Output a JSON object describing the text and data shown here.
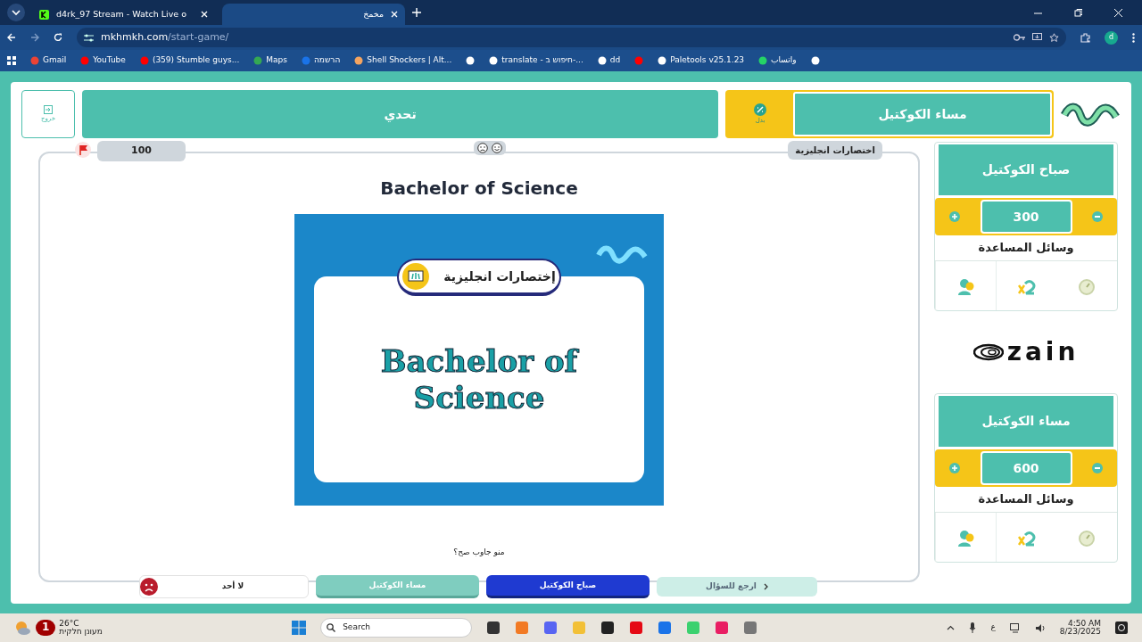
{
  "browser": {
    "tabs": [
      {
        "title": "مخمخ",
        "selected": true
      },
      {
        "title": "d4rk_97 Stream - Watch Live o",
        "selected": false
      }
    ],
    "address": {
      "host": "mkhmkh.com",
      "path": "/start-game/"
    },
    "profile_initial": "d",
    "bookmarks": [
      {
        "kind": "icon"
      },
      {
        "kind": "link",
        "label": "واتساب"
      },
      {
        "kind": "link",
        "label": "Paletools v25.1.23"
      },
      {
        "kind": "icon"
      },
      {
        "kind": "link",
        "label": "dd"
      },
      {
        "kind": "link",
        "label": "translate - חיפוש ב-..."
      },
      {
        "kind": "icon"
      },
      {
        "kind": "link",
        "label": "Shell Shockers | Alt..."
      },
      {
        "kind": "link",
        "label": "הרשמה"
      },
      {
        "kind": "link",
        "label": "Maps"
      },
      {
        "kind": "link",
        "label": "(359) Stumble guys..."
      },
      {
        "kind": "link",
        "label": "YouTube"
      },
      {
        "kind": "link",
        "label": "Gmail"
      }
    ]
  },
  "header": {
    "current_team": "مساء الكوكتيل",
    "swap_label": "بدل",
    "challenge_label": "تحدي",
    "exit_label": "خروج"
  },
  "teams": [
    {
      "name": "صباح الكوكتيل",
      "score": "300",
      "aids_label": "وسائل المساعدة"
    },
    {
      "name": "مساء الكوكتيل",
      "score": "600",
      "aids_label": "وسائل المساعدة"
    }
  ],
  "sponsor": "zain",
  "board": {
    "category": "اختصارات انجليزية",
    "points": "100",
    "question": "Bachelor of Science",
    "card": {
      "category": "إختصارات انجليزية",
      "text_lines": [
        "Bachelor of",
        "Science"
      ]
    },
    "prompt": "منو جاوب صح؟",
    "back_label": "ارجع للسؤال",
    "answers": [
      {
        "kind": "team",
        "label": "صباح الكوكتيل",
        "selected": true
      },
      {
        "kind": "team",
        "label": "مساء الكوكتيل",
        "selected": false
      },
      {
        "kind": "none",
        "label": "لا أحد",
        "selected": false
      }
    ]
  },
  "taskbar": {
    "weather": {
      "temp": "26°C",
      "condition": "מעונן חלקית",
      "badge": "1"
    },
    "search": "Search",
    "keyboard": "ع",
    "time": "4:50 AM",
    "date": "8/23/2025"
  }
}
